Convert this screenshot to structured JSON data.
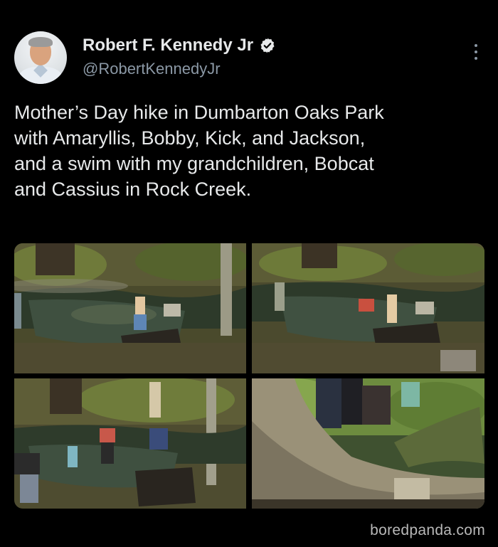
{
  "author": {
    "name": "Robert F. Kennedy Jr",
    "handle": "@RobertKennedyJr",
    "verified": true
  },
  "icons": {
    "verified": "verified-badge-icon",
    "more": "more-options-icon"
  },
  "tweet": {
    "text": "Mother’s Day hike in Dumbarton Oaks Park\nwith Amaryllis, Bobby, Kick, and Jackson,\nand a swim with my grandchildren, Bobcat\nand Cassius in Rock Creek."
  },
  "media": {
    "count": 4
  },
  "watermark": "boredpanda.com",
  "colors": {
    "background": "#000000",
    "text": "#e7e9ea",
    "secondary": "#8b98a5",
    "verified_badge": "#e7e9ea"
  }
}
